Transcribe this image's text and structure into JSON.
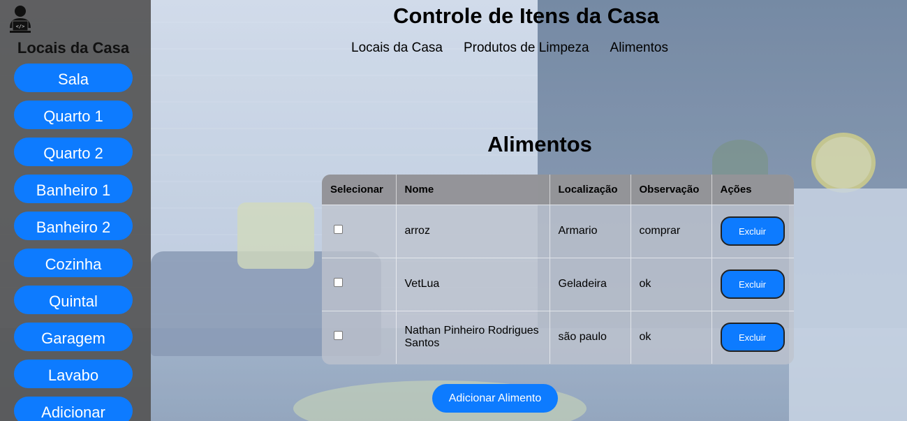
{
  "header": {
    "title": "Controle de Itens da Casa",
    "nav": [
      "Locais da Casa",
      "Produtos de Limpeza",
      "Alimentos"
    ]
  },
  "sidebar": {
    "title": "Locais da Casa",
    "items": [
      {
        "label": "Sala"
      },
      {
        "label": "Quarto 1"
      },
      {
        "label": "Quarto 2"
      },
      {
        "label": "Banheiro 1"
      },
      {
        "label": "Banheiro 2"
      },
      {
        "label": "Cozinha"
      },
      {
        "label": "Quintal"
      },
      {
        "label": "Garagem"
      },
      {
        "label": "Lavabo"
      },
      {
        "label": "Adicionar"
      }
    ]
  },
  "main": {
    "section_title": "Alimentos",
    "table": {
      "columns": [
        "Selecionar",
        "Nome",
        "Localização",
        "Observação",
        "Ações"
      ],
      "rows": [
        {
          "nome": "arroz",
          "localizacao": "Armario",
          "observacao": "comprar",
          "acao": "Excluir"
        },
        {
          "nome": "VetLua",
          "localizacao": "Geladeira",
          "observacao": "ok",
          "acao": "Excluir"
        },
        {
          "nome": "Nathan Pinheiro Rodrigues Santos",
          "localizacao": "são paulo",
          "observacao": "ok",
          "acao": "Excluir"
        }
      ]
    },
    "add_button": "Adicionar Alimento"
  },
  "icons": {
    "user": "user-laptop-icon"
  },
  "colors": {
    "accent": "#0d7bff",
    "sidebar_bg": "#555555"
  }
}
